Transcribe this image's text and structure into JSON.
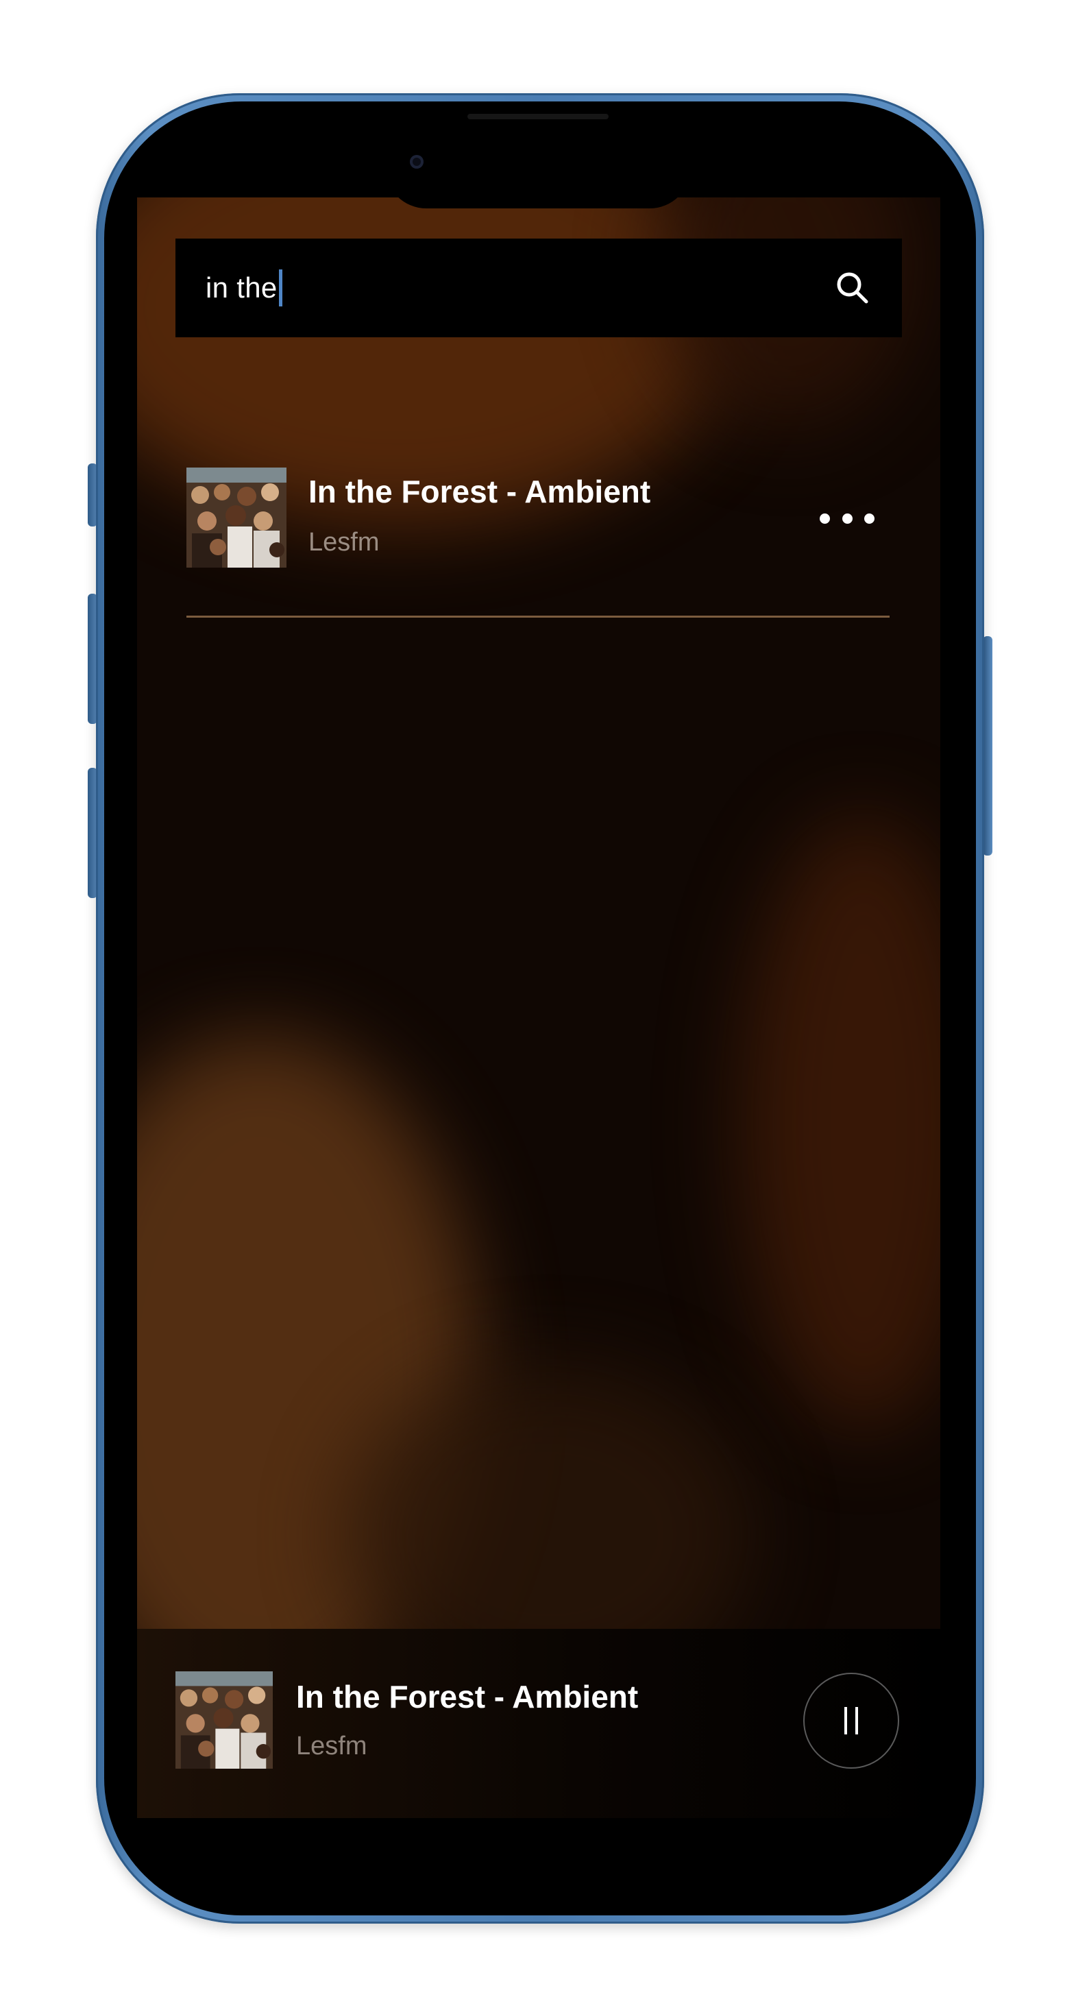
{
  "search": {
    "query": "in the",
    "icon": "search-icon"
  },
  "results": [
    {
      "title": "In the Forest - Ambient",
      "artist": "Lesfm",
      "thumbnail": "crowd-album-art",
      "menu_icon": "more-horizontal-icon"
    }
  ],
  "now_playing": {
    "title": "In the Forest - Ambient",
    "artist": "Lesfm",
    "thumbnail": "crowd-album-art",
    "control_icon": "pause-icon",
    "state": "playing"
  },
  "colors": {
    "background_warm": "#5a2a0c",
    "background_dark": "#120703",
    "search_bar": "#000000",
    "caret": "#4f86c6",
    "divider": "#7b5b3e",
    "artist_text": "#9b8d83",
    "phone_frame": "#4b7db2"
  }
}
